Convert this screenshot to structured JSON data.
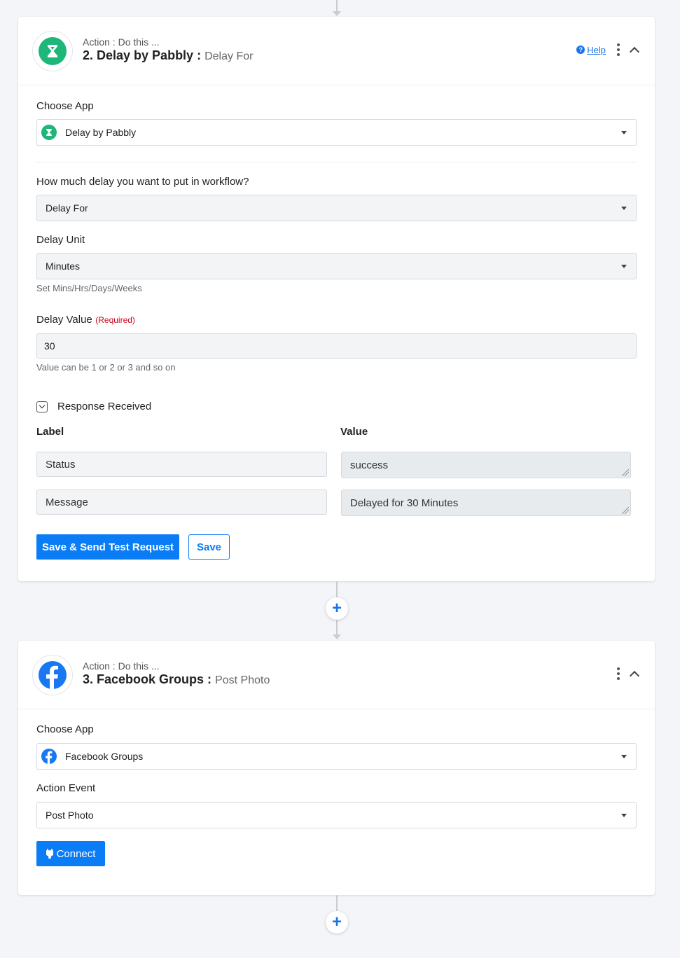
{
  "step2": {
    "subtitle": "Action : Do this ...",
    "title": "2. Delay by Pabbly :",
    "event": "Delay For",
    "help_label": "Help",
    "choose_app_label": "Choose App",
    "app_value": "Delay by Pabbly",
    "delay_question_label": "How much delay you want to put in workflow?",
    "delay_type_value": "Delay For",
    "delay_unit_label": "Delay Unit",
    "delay_unit_value": "Minutes",
    "delay_unit_help": "Set Mins/Hrs/Days/Weeks",
    "delay_value_label": "Delay Value",
    "required_label": "(Required)",
    "delay_value": "30",
    "delay_value_help": "Value can be 1 or 2 or 3 and so on",
    "response_label": "Response Received",
    "col_label": "Label",
    "col_value": "Value",
    "rows": [
      {
        "label": "Status",
        "value": "success"
      },
      {
        "label": "Message",
        "value": "Delayed for 30 Minutes"
      }
    ],
    "save_send_label": "Save & Send Test Request",
    "save_label": "Save"
  },
  "step3": {
    "subtitle": "Action : Do this ...",
    "title": "3. Facebook Groups :",
    "event": "Post Photo",
    "choose_app_label": "Choose App",
    "app_value": "Facebook Groups",
    "action_event_label": "Action Event",
    "action_event_value": "Post Photo",
    "connect_label": "Connect"
  },
  "add_step_glyph": "+",
  "icons": {
    "delay_logo": "hourglass-icon",
    "facebook_logo": "facebook-icon",
    "connect_icon": "plug-icon"
  },
  "colors": {
    "primary": "#0a7cf5",
    "delay_green": "#1fb67a",
    "facebook_blue": "#1877f2",
    "required_red": "#d0021b"
  }
}
